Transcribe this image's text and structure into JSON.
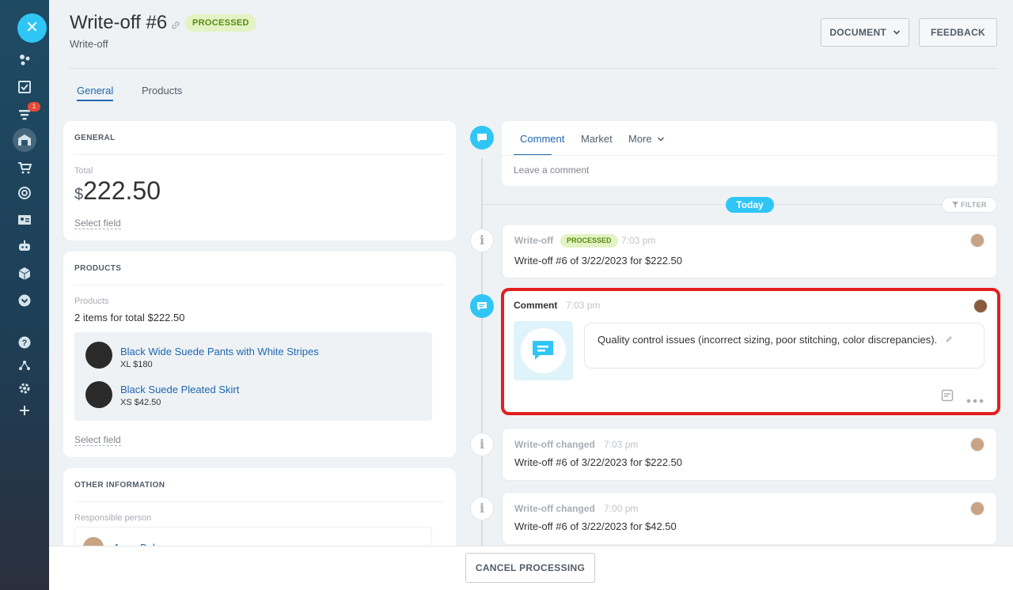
{
  "header": {
    "title": "Write-off #6",
    "status": "PROCESSED",
    "subtitle": "Write-off",
    "document_button": "DOCUMENT",
    "feedback_button": "FEEDBACK"
  },
  "rail": {
    "badge": "1"
  },
  "tabs": [
    {
      "label": "General",
      "active": true
    },
    {
      "label": "Products",
      "active": false
    }
  ],
  "general_card": {
    "title": "GENERAL",
    "total_label": "Total",
    "currency": "$",
    "total_value": "222.50",
    "select_field": "Select field"
  },
  "products_card": {
    "title": "PRODUCTS",
    "label": "Products",
    "summary": "2 items for total $222.50",
    "items": [
      {
        "name": "Black Wide Suede Pants with White Stripes",
        "meta": "XL  $180"
      },
      {
        "name": "Black Suede Pleated Skirt",
        "meta": "XS  $42.50"
      }
    ],
    "select_field": "Select field"
  },
  "other_card": {
    "title": "OTHER INFORMATION",
    "responsible_label": "Responsible person",
    "person_name": "Anna Bal"
  },
  "composer": {
    "tabs": [
      "Comment",
      "Market",
      "More"
    ],
    "placeholder": "Leave a comment"
  },
  "timeline": {
    "today": "Today",
    "filter": "FILTER",
    "entries": [
      {
        "title": "Write-off",
        "chip": "PROCESSED",
        "time": "7:03 pm",
        "body": "Write-off #6 of 3/22/2023 for $222.50"
      },
      {
        "title": "Write-off changed",
        "time": "7:03 pm",
        "body": "Write-off #6 of 3/22/2023 for $222.50"
      },
      {
        "title": "Write-off changed",
        "time": "7:00 pm",
        "body": "Write-off #6 of 3/22/2023 for $42.50"
      }
    ],
    "comment": {
      "label": "Comment",
      "time": "7:03 pm",
      "text": "Quality control issues (incorrect sizing, poor stitching, color discrepancies)."
    }
  },
  "footer": {
    "cancel_button": "CANCEL PROCESSING"
  },
  "colors": {
    "accent": "#2fc6f6",
    "link": "#2067b0",
    "status_bg": "#e3f3c4",
    "highlight": "#e31e1e"
  }
}
